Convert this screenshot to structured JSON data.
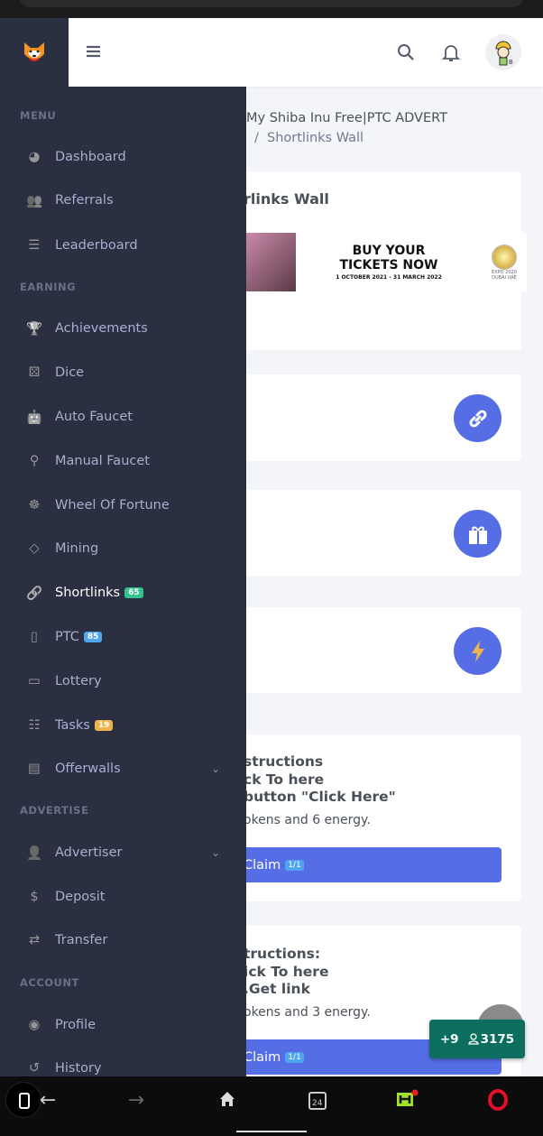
{
  "header": {
    "menu_icon": "hamburger-icon",
    "search_icon": "search-icon",
    "bell_icon": "bell-icon",
    "avatar": "miner-avatar"
  },
  "breadcrumb": {
    "site": "My Shiba Inu Free|PTC ADVERT",
    "separator": "/",
    "current": "Shortlinks Wall"
  },
  "sidebar": {
    "sections": {
      "menu": "MENU",
      "earning": "EARNING",
      "advertise": "ADVERTISE",
      "account": "ACCOUNT"
    },
    "items": [
      {
        "label": "Dashboard",
        "icon": "dashboard-icon"
      },
      {
        "label": "Referrals",
        "icon": "users-icon"
      },
      {
        "label": "Leaderboard",
        "icon": "ordered-list-icon"
      },
      {
        "label": "Achievements",
        "icon": "trophy-icon"
      },
      {
        "label": "Dice",
        "icon": "dice-icon"
      },
      {
        "label": "Auto Faucet",
        "icon": "robot-icon"
      },
      {
        "label": "Manual Faucet",
        "icon": "faucet-icon"
      },
      {
        "label": "Wheel Of Fortune",
        "icon": "wheel-icon"
      },
      {
        "label": "Mining",
        "icon": "diamond-icon"
      },
      {
        "label": "Shortlinks",
        "icon": "link-icon",
        "badge": "65",
        "badge_color": "#34c38f"
      },
      {
        "label": "PTC",
        "icon": "mouse-icon",
        "badge": "85",
        "badge_color": "#50a5f1"
      },
      {
        "label": "Lottery",
        "icon": "ticket-icon"
      },
      {
        "label": "Tasks",
        "icon": "tasks-icon",
        "badge": "19",
        "badge_color": "#f1b44c"
      },
      {
        "label": "Offerwalls",
        "icon": "newspaper-icon"
      },
      {
        "label": "Advertiser",
        "icon": "user-tie-icon"
      },
      {
        "label": "Deposit",
        "icon": "dollar-icon"
      },
      {
        "label": "Transfer",
        "icon": "transfer-icon"
      },
      {
        "label": "Profile",
        "icon": "user-circle-icon"
      },
      {
        "label": "History",
        "icon": "history-icon"
      }
    ]
  },
  "main": {
    "title": "rlinks Wall",
    "banner": {
      "line1": "BUY YOUR",
      "line2": "TICKETS NOW",
      "dates": "1 OCTOBER 2021 - 31 MARCH 2022",
      "logo": "EXPO 2020 DUBAI UAE"
    },
    "tasks": [
      {
        "lines": [
          "structions",
          "ck To here",
          "button \"Click Here\""
        ],
        "reward": "okens and 6 energy.",
        "claim": "Claim",
        "count": "1/1"
      },
      {
        "lines": [
          "tructions:",
          "ick To here",
          ".Get link"
        ],
        "reward": "okens and 3 energy.",
        "claim": "Claim",
        "count": "1/1"
      }
    ]
  },
  "online": {
    "plus": "+9",
    "count": "3175"
  },
  "colors": {
    "sidebar": "#2a3042",
    "accent": "#556ee6",
    "online": "#0b6e5e"
  }
}
